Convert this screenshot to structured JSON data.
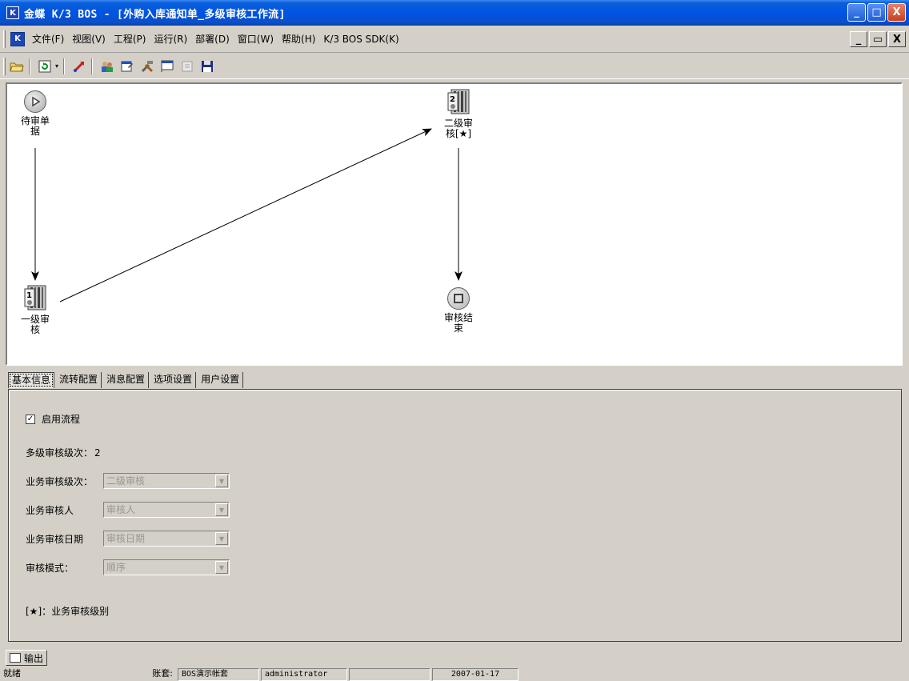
{
  "window": {
    "title": "金蝶 K/3 BOS - [外购入库通知单_多级审核工作流]",
    "icon": "kingdee-logo",
    "minimize": "_",
    "restore": "□",
    "close": "X"
  },
  "menu": {
    "items": [
      "文件(F)",
      "视图(V)",
      "工程(P)",
      "运行(R)",
      "部署(D)",
      "窗口(W)",
      "帮助(H)",
      "K/3 BOS SDK(K)"
    ],
    "mdi_minimize": "_",
    "mdi_restore": "▭",
    "mdi_close": "X"
  },
  "toolbar": {
    "icons": [
      "open-folder-icon",
      "refresh-icon",
      "dropdown-arrow-icon",
      "publish-icon",
      "users-icon",
      "properties-icon",
      "tools-icon",
      "output-window-icon",
      "disabled-icon",
      "save-icon"
    ]
  },
  "workflow": {
    "nodes": {
      "start": "待审单据",
      "level1": "一级审核",
      "level2": "二级审核[★]",
      "end": "审核结束"
    }
  },
  "tabs": [
    "基本信息",
    "流转配置",
    "消息配置",
    "选项设置",
    "用户设置"
  ],
  "panel": {
    "enable_flow": "启用流程",
    "levels_label": "多级审核级次：",
    "levels_value": "2",
    "biz_level_label": "业务审核级次：",
    "biz_level_value": "二级审核",
    "biz_reviewer_label": "业务审核人",
    "biz_reviewer_value": "审核人",
    "biz_date_label": "业务审核日期",
    "biz_date_value": "审核日期",
    "mode_label": "审核模式：",
    "mode_value": "顺序",
    "note": "[★]：业务审核级别"
  },
  "output_tab": "输出",
  "statusbar": {
    "status": "就绪",
    "account_label": "账套:",
    "account_value": "BOS演示帐套",
    "user": "administrator",
    "empty": "",
    "date": "2007-01-17"
  }
}
